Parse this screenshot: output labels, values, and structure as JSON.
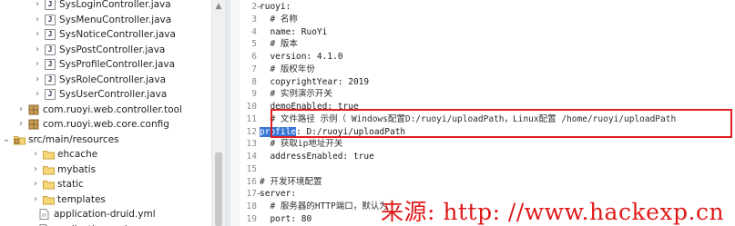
{
  "explorer": {
    "items": [
      {
        "label": "SysLoginController.java",
        "icon": "java-file-icon",
        "arrow": "›"
      },
      {
        "label": "SysMenuController.java",
        "icon": "java-file-icon",
        "arrow": "›"
      },
      {
        "label": "SysNoticeController.java",
        "icon": "java-file-icon",
        "arrow": "›"
      },
      {
        "label": "SysPostController.java",
        "icon": "java-file-icon",
        "arrow": "›"
      },
      {
        "label": "SysProfileController.java",
        "icon": "java-file-icon",
        "arrow": "›"
      },
      {
        "label": "SysRoleController.java",
        "icon": "java-file-icon",
        "arrow": "›"
      },
      {
        "label": "SysUserController.java",
        "icon": "java-file-icon",
        "arrow": "›"
      },
      {
        "label": "com.ruoyi.web.controller.tool",
        "icon": "package-icon",
        "arrow": "›"
      },
      {
        "label": "com.ruoyi.web.core.config",
        "icon": "package-icon",
        "arrow": "›"
      },
      {
        "label": "src/main/resources",
        "icon": "source-folder-icon",
        "arrow": "⌄"
      },
      {
        "label": "ehcache",
        "icon": "folder-icon",
        "arrow": "›"
      },
      {
        "label": "mybatis",
        "icon": "folder-icon",
        "arrow": "›"
      },
      {
        "label": "static",
        "icon": "folder-icon",
        "arrow": "›"
      },
      {
        "label": "templates",
        "icon": "folder-icon",
        "arrow": "›"
      },
      {
        "label": "application-druid.yml",
        "icon": "yml-file-icon",
        "arrow": ""
      },
      {
        "label": "application.yml",
        "icon": "yml-file-icon",
        "arrow": ""
      }
    ]
  },
  "editor": {
    "lines": [
      {
        "num": "2",
        "text": "ruoyi:",
        "fold": "−"
      },
      {
        "num": "3",
        "text": "  # 名称",
        "fold": ""
      },
      {
        "num": "4",
        "text": "  name: RuoYi",
        "fold": ""
      },
      {
        "num": "5",
        "text": "  # 版本",
        "fold": ""
      },
      {
        "num": "6",
        "text": "  version: 4.1.0",
        "fold": ""
      },
      {
        "num": "7",
        "text": "  # 版权年份",
        "fold": ""
      },
      {
        "num": "8",
        "text": "  copyrightYear: 2019",
        "fold": ""
      },
      {
        "num": "9",
        "text": "  # 实例演示开关",
        "fold": ""
      },
      {
        "num": "10",
        "text": "  demoEnabled: true",
        "fold": ""
      },
      {
        "num": "11",
        "text": "  # 文件路径 示例（ Windows配置D:/ruoyi/uploadPath，Linux配置 /home/ruoyi/uploadPath",
        "fold": ""
      },
      {
        "num": "12",
        "text_selected": "profile",
        "text_rest": ": D:/ruoyi/uploadPath",
        "fold": ""
      },
      {
        "num": "13",
        "text": "  # 获取ip地址开关",
        "fold": ""
      },
      {
        "num": "14",
        "text": "  addressEnabled: true",
        "fold": ""
      },
      {
        "num": "15",
        "text": "",
        "fold": ""
      },
      {
        "num": "16",
        "text": "# 开发环境配置",
        "fold": ""
      },
      {
        "num": "17",
        "text": "server:",
        "fold": "−"
      },
      {
        "num": "18",
        "text": "  # 服务器的HTTP端口，默认为",
        "fold": ""
      },
      {
        "num": "19",
        "text": "  port: 80",
        "fold": ""
      }
    ]
  },
  "watermark": {
    "text": "来源: http: //www.hackexp.cn"
  },
  "colors": {
    "highlight_box": "#e02020",
    "selection": "#3875d7",
    "watermark": "#e01818"
  }
}
